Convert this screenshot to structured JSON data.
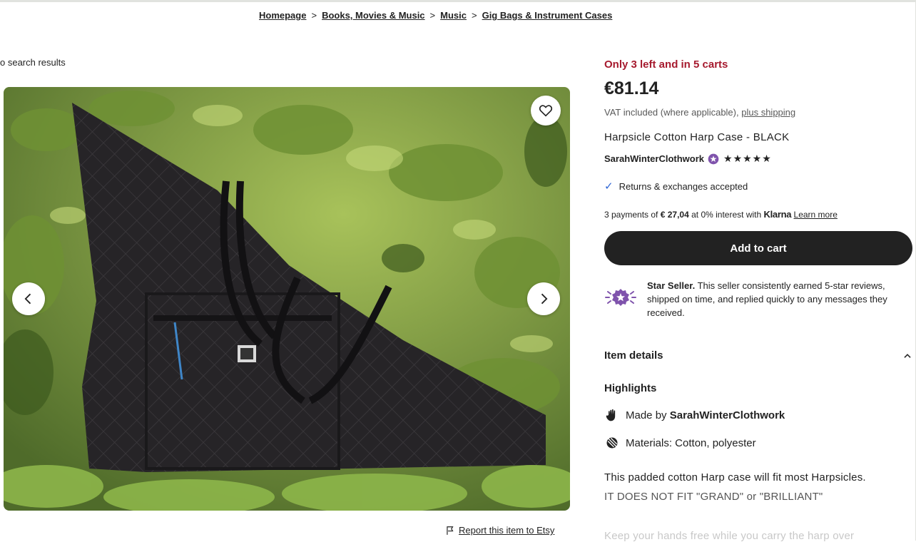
{
  "breadcrumb": {
    "items": [
      "Homepage",
      "Books, Movies & Music",
      "Music",
      "Gig Bags & Instrument Cases"
    ],
    "separator": ">"
  },
  "back_link": "o search results",
  "report": {
    "label": "Report this item to Etsy",
    "icon": "flag-icon"
  },
  "listing": {
    "stock_notice": "Only 3 left and in 5 carts",
    "price": "€81.14",
    "vat_text": "VAT included (where applicable),",
    "shipping_link": "plus shipping",
    "title": "Harpsicle Cotton Harp Case - BLACK",
    "seller_name": "SarahWinterClothwork",
    "rating_stars": "★★★★★",
    "rating_value": 5,
    "returns_text": "Returns & exchanges accepted",
    "klarna": {
      "prefix": "3 payments of",
      "amount": "€ 27,04",
      "middle": "at 0% interest with",
      "brand": "Klarna",
      "learn_more": "Learn more"
    },
    "add_to_cart": "Add to cart",
    "star_seller": {
      "heading": "Star Seller.",
      "body": "This seller consistently earned 5-star reviews, shipped on time, and replied quickly to any messages they received."
    },
    "item_details_label": "Item details",
    "highlights_label": "Highlights",
    "made_by_prefix": "Made by",
    "made_by_name": "SarahWinterClothwork",
    "materials": "Materials: Cotton, polyester",
    "description_line1": "This padded cotton Harp case will fit most Harpsicles.",
    "description_line2": "IT DOES NOT FIT \"GRAND\" or \"BRILLIANT\"",
    "description_line3": "Keep your hands free while you carry the harp over"
  },
  "colors": {
    "accent_red": "#a61a2e",
    "button_dark": "#222222",
    "check_blue": "#2f66d5",
    "star_seller_purple": "#7f53ac"
  },
  "icons": [
    "heart-icon",
    "chevron-left-icon",
    "chevron-right-icon",
    "flag-icon",
    "star-seller-badge-icon",
    "check-icon",
    "chevron-up-icon",
    "hand-icon",
    "materials-icon"
  ]
}
